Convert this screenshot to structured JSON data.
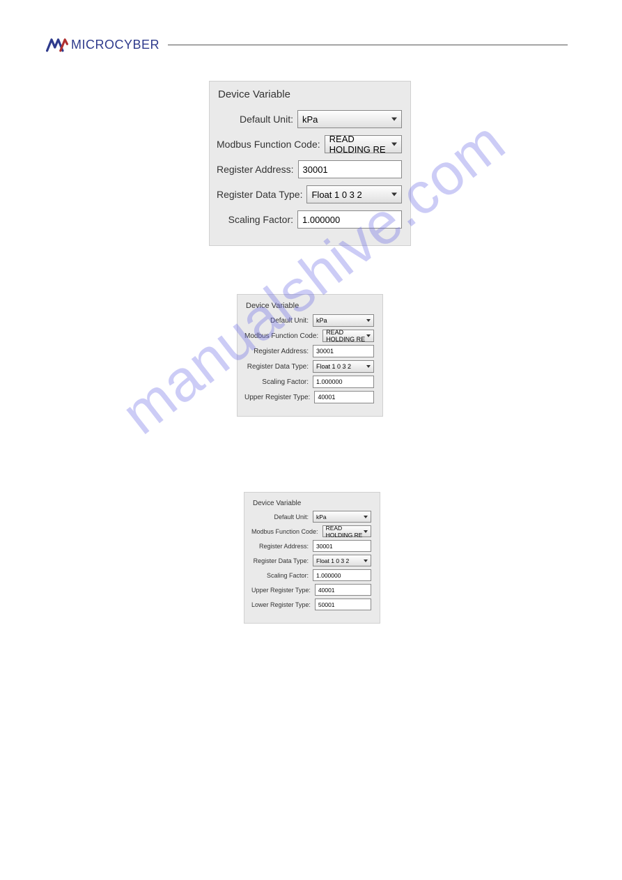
{
  "header": {
    "brand_part1": "MICRO",
    "brand_part2": "CYBER"
  },
  "watermark": "manualshive.com",
  "panel1": {
    "title": "Device  Variable",
    "default_unit_label": "Default Unit:",
    "default_unit_value": "kPa",
    "func_code_label": "Modbus Function Code:",
    "func_code_value": "READ HOLDING RE",
    "reg_addr_label": "Register Address:",
    "reg_addr_value": "30001",
    "reg_data_type_label": "Register Data Type:",
    "reg_data_type_value": "Float 1 0 3 2",
    "scaling_label": "Scaling Factor:",
    "scaling_value": "1.000000"
  },
  "panel2": {
    "title": "Device  Variable",
    "default_unit_label": "Default Unit:",
    "default_unit_value": "kPa",
    "func_code_label": "Modbus Function Code:",
    "func_code_value": "READ HOLDING RE",
    "reg_addr_label": "Register Address:",
    "reg_addr_value": "30001",
    "reg_data_type_label": "Register Data Type:",
    "reg_data_type_value": "Float 1 0 3 2",
    "scaling_label": "Scaling Factor:",
    "scaling_value": "1.000000",
    "upper_reg_label": "Upper Register Type:",
    "upper_reg_value": "40001"
  },
  "panel3": {
    "title": "Device  Variable",
    "default_unit_label": "Default Unit:",
    "default_unit_value": "kPa",
    "func_code_label": "Modbus Function Code:",
    "func_code_value": "READ HOLDING RE",
    "reg_addr_label": "Register Address:",
    "reg_addr_value": "30001",
    "reg_data_type_label": "Register Data Type:",
    "reg_data_type_value": "Float 1 0 3 2",
    "scaling_label": "Scaling Factor:",
    "scaling_value": "1.000000",
    "upper_reg_label": "Upper Register Type:",
    "upper_reg_value": "40001",
    "lower_reg_label": "Lower Register Type:",
    "lower_reg_value": "50001"
  }
}
